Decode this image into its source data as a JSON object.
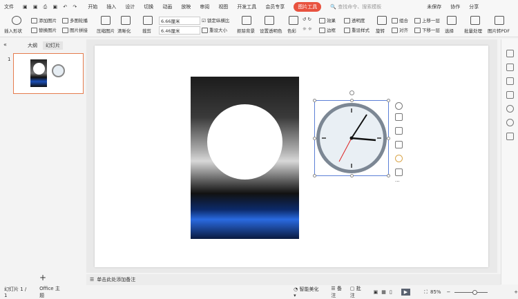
{
  "menu": {
    "file": "文件",
    "tabs": [
      "开始",
      "插入",
      "设计",
      "切换",
      "动画",
      "放映",
      "审阅",
      "视图",
      "开发工具",
      "会员专享"
    ],
    "active_tool_tab": "图片工具",
    "search_placeholder": "查找命令、搜索模板",
    "unsaved": "未保存",
    "collab": "协作",
    "share": "分享"
  },
  "ribbon": {
    "insert_shape": "插入形状",
    "add_picture": "添加图片",
    "replace_picture": "替换图片",
    "multi_crop": "多图轮播",
    "picture_split": "图片拼接",
    "compress": "压缩图片",
    "clarity": "清晰化",
    "crop": "裁剪",
    "width": "6.66厘米",
    "height": "6.46厘米",
    "lock_ratio": "锁定纵横比",
    "reset_size": "重设大小",
    "remove_bg": "抠除背景",
    "set_transparent": "设置透明色",
    "color": "色彩",
    "effects": "效果",
    "border": "边框",
    "transparency": "透明度",
    "reset_style": "重设样式",
    "rotate": "旋转",
    "group": "组合",
    "align": "对齐",
    "bring_forward": "上移一层",
    "send_backward": "下移一层",
    "select": "选择",
    "batch": "批量处理",
    "to_pdf": "图片转PDF"
  },
  "left_panel": {
    "tab_outline": "大纲",
    "tab_slides": "幻灯片",
    "slide_number": "1"
  },
  "notes": {
    "placeholder": "单击此处添加备注"
  },
  "status": {
    "slide_info": "幻灯片 1 / 1",
    "theme": "Office 主题",
    "beautify": "智能美化",
    "notes": "备注",
    "comments": "批注",
    "zoom": "85%"
  },
  "colors": {
    "accent": "#e8523f",
    "selection": "#5b7fd6"
  }
}
